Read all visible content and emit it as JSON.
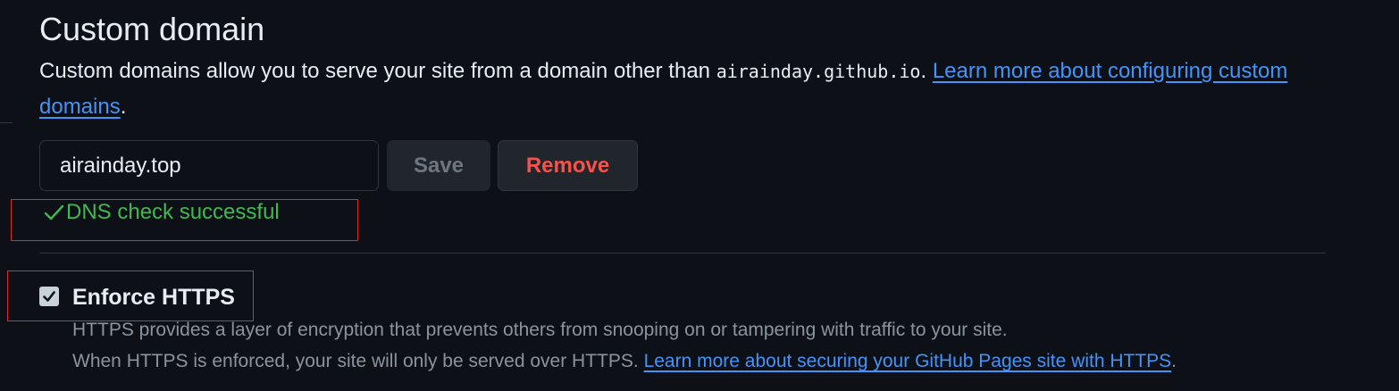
{
  "section": {
    "title": "Custom domain",
    "description_prefix": "Custom domains allow you to serve your site from a domain other than ",
    "default_domain": "airainday.github.io",
    "description_mid": ". ",
    "learn_more_link": "Learn more about configuring custom domains",
    "description_suffix": "."
  },
  "domain_form": {
    "input_value": "airainday.top",
    "save_label": "Save",
    "remove_label": "Remove"
  },
  "dns": {
    "status_text": "DNS check successful",
    "status_color": "#3fb950"
  },
  "https": {
    "checkbox_checked": true,
    "label": "Enforce HTTPS",
    "help_line1": "HTTPS provides a layer of encryption that prevents others from snooping on or tampering with traffic to your site.",
    "help_line2_prefix": "When HTTPS is enforced, your site will only be served over HTTPS. ",
    "help_link": "Learn more about securing your GitHub Pages site with HTTPS",
    "help_line2_suffix": "."
  },
  "colors": {
    "background": "#0d1117",
    "link": "#4493f8",
    "danger": "#f85149",
    "annotation_box": "#d32f2f"
  }
}
